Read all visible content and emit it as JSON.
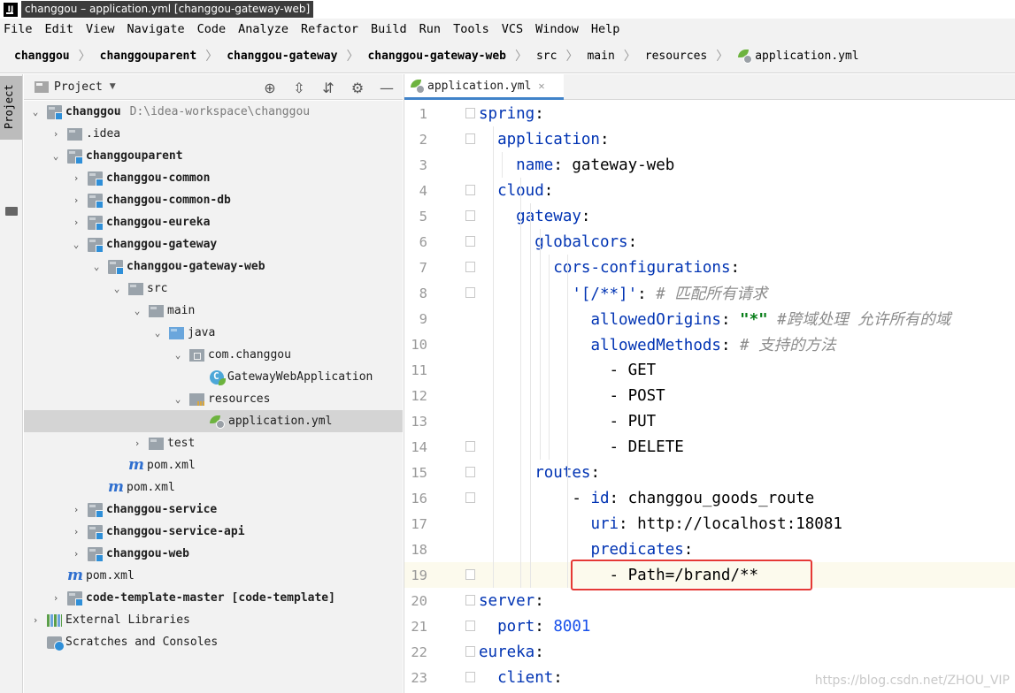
{
  "window": {
    "title": "changgou – application.yml [changgou-gateway-web]"
  },
  "menu": [
    "File",
    "Edit",
    "View",
    "Navigate",
    "Code",
    "Analyze",
    "Refactor",
    "Build",
    "Run",
    "Tools",
    "VCS",
    "Window",
    "Help"
  ],
  "breadcrumb": [
    "changgou",
    "changgouparent",
    "changgou-gateway",
    "changgou-gateway-web",
    "src",
    "main",
    "resources",
    "application.yml"
  ],
  "project_panel": {
    "label": "Project",
    "side_tab": "Project"
  },
  "tree": [
    {
      "arrow": "⌄",
      "icon": "mod",
      "label": "changgou",
      "path": "D:\\idea-workspace\\changgou",
      "bold": true
    },
    {
      "arrow": "›",
      "icon": "fold",
      "label": ".idea"
    },
    {
      "arrow": "⌄",
      "icon": "mod",
      "label": "changgouparent",
      "bold": true
    },
    {
      "arrow": "›",
      "icon": "mod",
      "label": "changgou-common",
      "bold": true
    },
    {
      "arrow": "›",
      "icon": "mod",
      "label": "changgou-common-db",
      "bold": true
    },
    {
      "arrow": "›",
      "icon": "mod",
      "label": "changgou-eureka",
      "bold": true
    },
    {
      "arrow": "⌄",
      "icon": "mod",
      "label": "changgou-gateway",
      "bold": true
    },
    {
      "arrow": "⌄",
      "icon": "mod",
      "label": "changgou-gateway-web",
      "bold": true
    },
    {
      "arrow": "⌄",
      "icon": "fold",
      "label": "src"
    },
    {
      "arrow": "⌄",
      "icon": "fold",
      "label": "main"
    },
    {
      "arrow": "⌄",
      "icon": "blue",
      "label": "java"
    },
    {
      "arrow": "⌄",
      "icon": "pkg",
      "label": "com.changgou"
    },
    {
      "arrow": "",
      "icon": "cls",
      "label": "GatewayWebApplication"
    },
    {
      "arrow": "⌄",
      "icon": "res",
      "label": "resources"
    },
    {
      "arrow": "",
      "icon": "leaf",
      "label": "application.yml",
      "selected": true
    },
    {
      "arrow": "›",
      "icon": "fold",
      "label": "test"
    },
    {
      "arrow": "",
      "icon": "mvn",
      "label": "pom.xml"
    },
    {
      "arrow": "",
      "icon": "mvn",
      "label": "pom.xml"
    },
    {
      "arrow": "›",
      "icon": "mod",
      "label": "changgou-service",
      "bold": true
    },
    {
      "arrow": "›",
      "icon": "mod",
      "label": "changgou-service-api",
      "bold": true
    },
    {
      "arrow": "›",
      "icon": "mod",
      "label": "changgou-web",
      "bold": true
    },
    {
      "arrow": "",
      "icon": "mvn",
      "label": "pom.xml"
    },
    {
      "arrow": "›",
      "icon": "mod",
      "label": "code-template-master",
      "suffix": "[code-template]",
      "bold": true
    },
    {
      "arrow": "›",
      "icon": "lib",
      "label": "External Libraries"
    },
    {
      "arrow": "",
      "icon": "scr",
      "label": "Scratches and Consoles"
    }
  ],
  "editor": {
    "tab_label": "application.yml",
    "current_line": 19,
    "lines": [
      [
        {
          "t": "k",
          "v": "spring"
        },
        {
          "t": "p",
          "v": ":"
        }
      ],
      [
        {
          "t": "p",
          "v": "  "
        },
        {
          "t": "k",
          "v": "application"
        },
        {
          "t": "p",
          "v": ":"
        }
      ],
      [
        {
          "t": "p",
          "v": "    "
        },
        {
          "t": "k",
          "v": "name"
        },
        {
          "t": "p",
          "v": ": gateway-web"
        }
      ],
      [
        {
          "t": "p",
          "v": "  "
        },
        {
          "t": "k",
          "v": "cloud"
        },
        {
          "t": "p",
          "v": ":"
        }
      ],
      [
        {
          "t": "p",
          "v": "    "
        },
        {
          "t": "k",
          "v": "gateway"
        },
        {
          "t": "p",
          "v": ":"
        }
      ],
      [
        {
          "t": "p",
          "v": "      "
        },
        {
          "t": "k",
          "v": "globalcors"
        },
        {
          "t": "p",
          "v": ":"
        }
      ],
      [
        {
          "t": "p",
          "v": "        "
        },
        {
          "t": "k",
          "v": "cors-configurations"
        },
        {
          "t": "p",
          "v": ":"
        }
      ],
      [
        {
          "t": "p",
          "v": "          "
        },
        {
          "t": "k",
          "v": "'[/**]'"
        },
        {
          "t": "p",
          "v": ": "
        },
        {
          "t": "c",
          "v": "# 匹配所有请求"
        }
      ],
      [
        {
          "t": "p",
          "v": "            "
        },
        {
          "t": "k",
          "v": "allowedOrigins"
        },
        {
          "t": "p",
          "v": ": "
        },
        {
          "t": "s",
          "v": "\"*\""
        },
        {
          "t": "p",
          "v": " "
        },
        {
          "t": "c",
          "v": "#跨域处理 允许所有的域"
        }
      ],
      [
        {
          "t": "p",
          "v": "            "
        },
        {
          "t": "k",
          "v": "allowedMethods"
        },
        {
          "t": "p",
          "v": ": "
        },
        {
          "t": "c",
          "v": "# 支持的方法"
        }
      ],
      [
        {
          "t": "p",
          "v": "              - GET"
        }
      ],
      [
        {
          "t": "p",
          "v": "              - POST"
        }
      ],
      [
        {
          "t": "p",
          "v": "              - PUT"
        }
      ],
      [
        {
          "t": "p",
          "v": "              - DELETE"
        }
      ],
      [
        {
          "t": "p",
          "v": "      "
        },
        {
          "t": "k",
          "v": "routes"
        },
        {
          "t": "p",
          "v": ":"
        }
      ],
      [
        {
          "t": "p",
          "v": "          - "
        },
        {
          "t": "k",
          "v": "id"
        },
        {
          "t": "p",
          "v": ": changgou_goods_route"
        }
      ],
      [
        {
          "t": "p",
          "v": "            "
        },
        {
          "t": "k",
          "v": "uri"
        },
        {
          "t": "p",
          "v": ": http://localhost:18081"
        }
      ],
      [
        {
          "t": "p",
          "v": "            "
        },
        {
          "t": "k",
          "v": "predicates"
        },
        {
          "t": "p",
          "v": ":"
        }
      ],
      [
        {
          "t": "p",
          "v": "              - Path=/brand/**"
        }
      ],
      [
        {
          "t": "k",
          "v": "server"
        },
        {
          "t": "p",
          "v": ":"
        }
      ],
      [
        {
          "t": "p",
          "v": "  "
        },
        {
          "t": "k",
          "v": "port"
        },
        {
          "t": "p",
          "v": ": "
        },
        {
          "t": "n",
          "v": "8001"
        }
      ],
      [
        {
          "t": "k",
          "v": "eureka"
        },
        {
          "t": "p",
          "v": ":"
        }
      ],
      [
        {
          "t": "p",
          "v": "  "
        },
        {
          "t": "k",
          "v": "client"
        },
        {
          "t": "p",
          "v": ":"
        }
      ]
    ]
  },
  "watermark": "https://blog.csdn.net/ZHOU_VIP"
}
